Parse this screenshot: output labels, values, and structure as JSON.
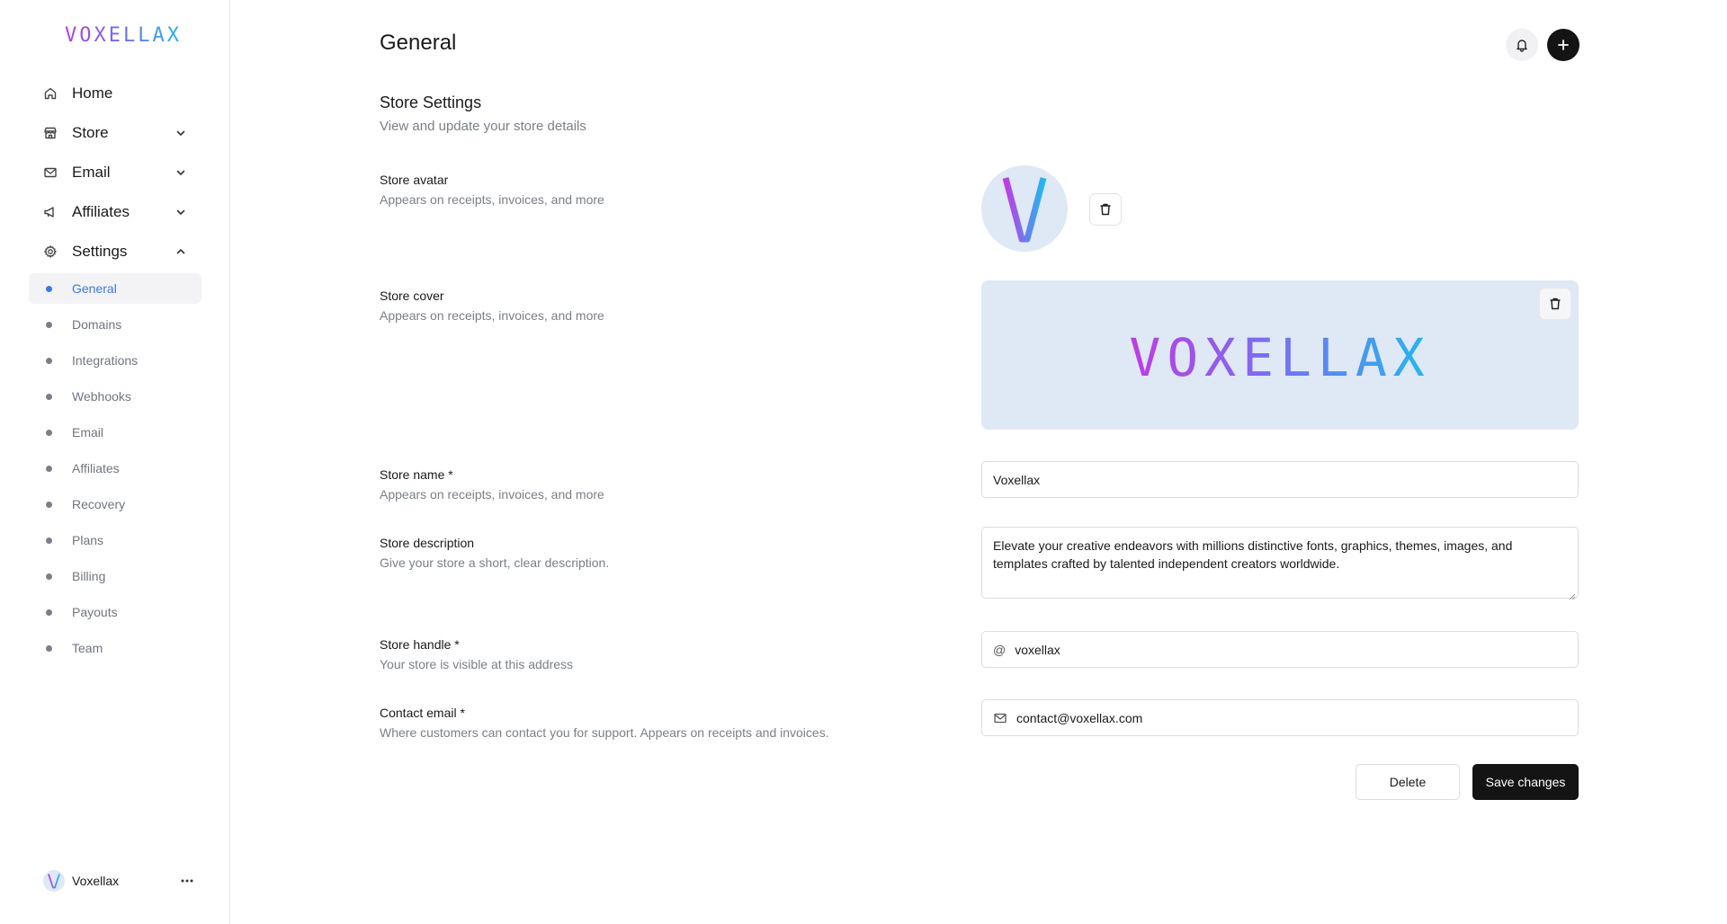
{
  "app": {
    "logo_text": "VOXELLAX"
  },
  "sidebar": {
    "nav": [
      {
        "label": "Home",
        "icon": "home-icon"
      },
      {
        "label": "Store",
        "icon": "store-icon",
        "expandable": true,
        "expanded": false
      },
      {
        "label": "Email",
        "icon": "mail-icon",
        "expandable": true,
        "expanded": false
      },
      {
        "label": "Affiliates",
        "icon": "megaphone-icon",
        "expandable": true,
        "expanded": false
      },
      {
        "label": "Settings",
        "icon": "gear-icon",
        "expandable": true,
        "expanded": true
      }
    ],
    "settings_items": [
      {
        "label": "General",
        "active": true
      },
      {
        "label": "Domains"
      },
      {
        "label": "Integrations"
      },
      {
        "label": "Webhooks"
      },
      {
        "label": "Email"
      },
      {
        "label": "Affiliates"
      },
      {
        "label": "Recovery"
      },
      {
        "label": "Plans"
      },
      {
        "label": "Billing"
      },
      {
        "label": "Payouts"
      },
      {
        "label": "Team"
      }
    ],
    "user": {
      "name": "Voxellax",
      "avatar_letter": "V"
    }
  },
  "header": {
    "title": "General"
  },
  "section": {
    "title": "Store Settings",
    "subtitle": "View and update your store details"
  },
  "fields": {
    "avatar": {
      "label": "Store avatar",
      "help": "Appears on receipts, invoices, and more",
      "letter": "V"
    },
    "cover": {
      "label": "Store cover",
      "help": "Appears on receipts, invoices, and more",
      "logo_text": "VOXELLAX"
    },
    "name": {
      "label": "Store name *",
      "help": "Appears on receipts, invoices, and more",
      "value": "Voxellax"
    },
    "description": {
      "label": "Store description",
      "help": "Give your store a short, clear description.",
      "value": "Elevate your creative endeavors with millions distinctive fonts, graphics, themes, images, and templates crafted by talented independent creators worldwide."
    },
    "handle": {
      "label": "Store handle *",
      "help": "Your store is visible at this address",
      "prefix": "@",
      "value": "voxellax"
    },
    "email": {
      "label": "Contact email *",
      "help": "Where customers can contact you for support. Appears on receipts and invoices.",
      "value": "contact@voxellax.com"
    }
  },
  "actions": {
    "delete_label": "Delete",
    "save_label": "Save changes"
  },
  "colors": {
    "accent": "#3d7be0",
    "primary_button": "#141414",
    "cover_bg": "#dfe8f5"
  }
}
